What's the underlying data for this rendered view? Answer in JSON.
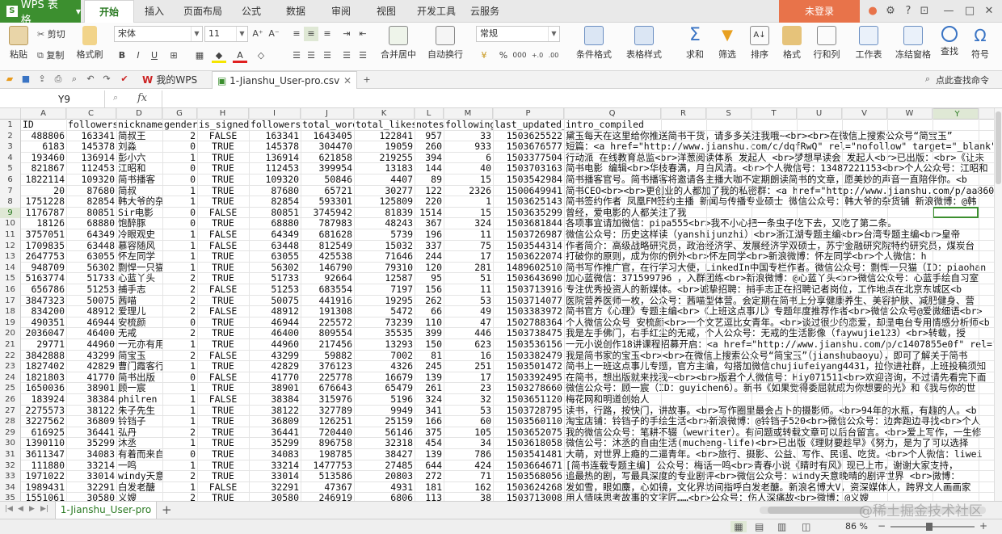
{
  "app": {
    "logo": "WPS 表格",
    "login": "未登录"
  },
  "menu_tabs": [
    "开始",
    "插入",
    "页面布局",
    "公式",
    "数据",
    "审阅",
    "视图",
    "开发工具",
    "云服务"
  ],
  "ribbon": {
    "paste": "粘贴",
    "cut": "剪切",
    "copy": "复制",
    "format_painter": "格式刷",
    "font_name": "宋体",
    "font_size": "11",
    "merge_center": "合并居中",
    "wrap": "自动换行",
    "number_format": "常规",
    "cond_format": "条件格式",
    "table_style": "表格样式",
    "sum": "求和",
    "filter": "筛选",
    "sort": "排序",
    "format": "格式",
    "row_col": "行和列",
    "worksheet": "工作表",
    "freeze": "冻结窗格",
    "find": "查找",
    "symbol": "符号"
  },
  "qa": {
    "home_tab": "我的WPS",
    "doc_tab": "1-Jianshu_User-pro.csv",
    "cmd_search": "点此查找命令"
  },
  "formula_bar": {
    "name_box": "Y9",
    "fx": "fx"
  },
  "columns": [
    "A",
    "B",
    "C",
    "D",
    "G",
    "H",
    "I",
    "J",
    "K",
    "L",
    "M",
    "P",
    "Q",
    "R",
    "S",
    "T",
    "U",
    "V",
    "W",
    "X",
    "Y"
  ],
  "rows": [
    {
      "n": "1",
      "a": "ID",
      "c": "followers",
      "d": "nickname",
      "g": "gender",
      "h": "is_signed",
      "i": "followers",
      "j": "total_word",
      "k": "total_likes",
      "l": "notes",
      "m": "following",
      "p": "last_updated_a",
      "q": "intro_compiled"
    },
    {
      "n": "2",
      "a": "488806",
      "c": "163341",
      "d": "简叔王",
      "g": "2",
      "h": "FALSE",
      "i": "163341",
      "j": "1643405",
      "k": "122841",
      "l": "957",
      "m": "33",
      "p": "1503625522",
      "q": "黛玉每天在这里给你推送简书干货，请多多关注我哦~<br><br>在微信上搜索公众号“简宝玉”"
    },
    {
      "n": "3",
      "a": "6183",
      "c": "145378",
      "d": "刘淼",
      "g": "0",
      "h": "TRUE",
      "i": "145378",
      "j": "304470",
      "k": "19059",
      "l": "260",
      "m": "933",
      "p": "1503676577",
      "q": "短篇：<a href=\"http://www.jianshu.com/c/dqfRwQ\" rel=\"nofollow\" target=\"_blank\">htt"
    },
    {
      "n": "4",
      "a": "193460",
      "c": "136914",
      "d": "彭小六",
      "g": "1",
      "h": "TRUE",
      "i": "136914",
      "j": "621858",
      "k": "219255",
      "l": "394",
      "m": "6",
      "p": "1503377504",
      "q": "行动派 在线教育总监<br>洋葱阅读体系 发起人 <br>梦想早读会 发起人<br>已出版：<br>《让未"
    },
    {
      "n": "5",
      "a": "821867",
      "c": "112453",
      "d": "江昭和",
      "g": "0",
      "h": "TRUE",
      "i": "112453",
      "j": "399954",
      "k": "13183",
      "l": "144",
      "m": "40",
      "p": "1503703163",
      "q": "简书电影 编辑<br>华枝春满，月白风清。<br>个人微信号：13487221153<br>个人公众号：江昭和"
    },
    {
      "n": "6",
      "a": "1822114",
      "c": "109320",
      "d": "简书播客",
      "g": "0",
      "h": "TRUE",
      "i": "109320",
      "j": "50846",
      "k": "4407",
      "l": "89",
      "m": "15",
      "p": "1503542984",
      "q": "简书播客官号。简书播客将邀请各主播大咖不定期朗读简书的文章，愿美妙的声音一直陪伴你。<b"
    },
    {
      "n": "7",
      "a": "20",
      "c": "87680",
      "d": "简叔",
      "g": "1",
      "h": "TRUE",
      "i": "87680",
      "j": "65721",
      "k": "30277",
      "l": "122",
      "m": "2326",
      "p": "1500649941",
      "q": "简书CEO<br><br>更创业的人都加了我的私密群：<a href=\"http://www.jianshu.com/p/aa860ce"
    },
    {
      "n": "8",
      "a": "1751228",
      "c": "82854",
      "d": "韩大爷的杂",
      "g": "1",
      "h": "TRUE",
      "i": "82854",
      "j": "593301",
      "k": "125809",
      "l": "220",
      "m": "1",
      "p": "1503625143",
      "q": "简书签约作者 凤凰FM签约主播 新闻与传播专业硕士 微信公众号：韩大爷的杂货铺  新浪微博：@韩"
    },
    {
      "n": "9",
      "a": "1176787",
      "c": "80851",
      "d": "Sir电影",
      "g": "0",
      "h": "FALSE",
      "i": "80851",
      "j": "3745942",
      "k": "81839",
      "l": "1514",
      "m": "15",
      "p": "1503635299",
      "q": "曾经，爱电影的人都关注了我"
    },
    {
      "n": "10",
      "a": "18126",
      "c": "68880",
      "d": "饱醉豚",
      "g": "0",
      "h": "TRUE",
      "i": "68880",
      "j": "787983",
      "k": "48243",
      "l": "367",
      "m": "324",
      "p": "1503681844",
      "q": "各项事宜请加微信：pipa555<br>我不小心把一条虫子吃下去，又吃了第二条。"
    },
    {
      "n": "11",
      "a": "3757051",
      "c": "64349",
      "d": "冷眼观史",
      "g": "1",
      "h": "FALSE",
      "i": "64349",
      "j": "681628",
      "k": "5739",
      "l": "196",
      "m": "11",
      "p": "1503726987",
      "q": "微信公众号：历史这样读（yanshijunzhi）<br>浙江湖专题主编<br>台湾专题主编<br>皇帝"
    },
    {
      "n": "12",
      "a": "1709835",
      "c": "63448",
      "d": "慕容随风",
      "g": "1",
      "h": "FALSE",
      "i": "63448",
      "j": "812549",
      "k": "15032",
      "l": "337",
      "m": "75",
      "p": "1503544314",
      "q": "作者简介：高级战略研究员，政治经济学、发展经济学双硕士，苏宁金融研究院特约研究员，煤炭台"
    },
    {
      "n": "13",
      "a": "2647753",
      "c": "63055",
      "d": "怀左同学",
      "g": "1",
      "h": "TRUE",
      "i": "63055",
      "j": "425538",
      "k": "71646",
      "l": "244",
      "m": "17",
      "p": "1503622074",
      "q": "打破你的原则，成为你的例外<br>怀左同学<br>新浪微博：怀左同学<br>个人微信：h"
    },
    {
      "n": "14",
      "a": "948709",
      "c": "56302",
      "d": "剽悍一只猫",
      "g": "1",
      "h": "TRUE",
      "i": "56302",
      "j": "146790",
      "k": "79310",
      "l": "120",
      "m": "281",
      "p": "1489602510",
      "q": "简书写作推广官，在行学习大使，LinkedIn中国专栏作者。微信公众号：剽悍一只猫（ID：piaohan"
    },
    {
      "n": "15",
      "a": "5163774",
      "c": "51733",
      "d": "心蓝丫头",
      "g": "2",
      "h": "TRUE",
      "i": "51733",
      "j": "92664",
      "k": "12587",
      "l": "95",
      "m": "51",
      "p": "1503643690",
      "q": "加心蓝微信：371599796  ，入群团练<br>新浪微博：@心蓝丫头<br>微信公众号：心蓝手绘自习室"
    },
    {
      "n": "16",
      "a": "656786",
      "c": "51253",
      "d": "捕手志",
      "g": "2",
      "h": "FALSE",
      "i": "51253",
      "j": "683554",
      "k": "7197",
      "l": "156",
      "m": "11",
      "p": "1503713916",
      "q": "专注优秀投资人的新媒体。<br>诚挚招聘：捕手志正在招聘记者岗位，工作地点在北京东城区<b"
    },
    {
      "n": "17",
      "a": "3847323",
      "c": "50075",
      "d": "茜喵",
      "g": "2",
      "h": "TRUE",
      "i": "50075",
      "j": "441916",
      "k": "19295",
      "l": "262",
      "m": "53",
      "p": "1503714077",
      "q": "医院营养医师一枚，公众号：茜喵型体营。会定期在简书上分享健康养生、美容护肤、减肥健身、营"
    },
    {
      "n": "18",
      "a": "834200",
      "c": "48912",
      "d": "爱理儿",
      "g": "2",
      "h": "FALSE",
      "i": "48912",
      "j": "191308",
      "k": "5472",
      "l": "66",
      "m": "49",
      "p": "1503383972",
      "q": "简书官方《心理》专题主编<br>《上班这点事儿》专题年度推荐作者<br>微信公众号@爱微细语<br>"
    },
    {
      "n": "19",
      "a": "490351",
      "c": "46944",
      "d": "安梳颜",
      "g": "0",
      "h": "TRUE",
      "i": "46944",
      "j": "225572",
      "k": "73239",
      "l": "110",
      "m": "47",
      "p": "1502788364",
      "q": "个人微信公众号 安梳颜<br>一个文艺逗比女青年。<br>谈过很少的恋爱，却是电台专用情感分析师<b"
    },
    {
      "n": "20",
      "a": "2036047",
      "c": "46400",
      "d": "无戒",
      "g": "2",
      "h": "TRUE",
      "i": "46400",
      "j": "809554",
      "k": "35535",
      "l": "399",
      "m": "446",
      "p": "1503738475",
      "q": "我是左手佛门，右手红尘的无戒，个人公众号：无戒的生活影像（faywujie123）<br>转载，授"
    },
    {
      "n": "21",
      "a": "29771",
      "c": "44960",
      "d": "一元亦有用",
      "g": "1",
      "h": "TRUE",
      "i": "44960",
      "j": "217456",
      "k": "13293",
      "l": "150",
      "m": "623",
      "p": "1503536156",
      "q": "一元小说创作18讲课程招募开启：<a href=\"http://www.jianshu.com/p/c1407855e0f\" rel=\""
    },
    {
      "n": "22",
      "a": "3842888",
      "c": "43299",
      "d": "简宝玉",
      "g": "2",
      "h": "FALSE",
      "i": "43299",
      "j": "59882",
      "k": "7002",
      "l": "81",
      "m": "16",
      "p": "1503382479",
      "q": "我是简书家的宝玉<br><br>在微信上搜索公众号“简宝玉”（jianshubaoyu），即可了解关于简书"
    },
    {
      "n": "23",
      "a": "1827402",
      "c": "42829",
      "d": "曹门霞客行",
      "g": "1",
      "h": "TRUE",
      "i": "42829",
      "j": "376123",
      "k": "4326",
      "l": "245",
      "m": "251",
      "p": "1503501472",
      "q": "简书上一班这点事儿专题，官方主编，勾搭加微信chujiufeiyang4431，拉你进社群，上班投稿须知"
    },
    {
      "n": "24",
      "a": "1821803",
      "c": "41770",
      "d": "简书出版",
      "g": "0",
      "h": "FALSE",
      "i": "41770",
      "j": "225778",
      "k": "16679",
      "l": "139",
      "m": "17",
      "p": "1503392495",
      "q": "在简书，想出版就来找我~<br><br>版君个人微信号：Hiy071511<br>欢迎咨询，不过请先看完下面"
    },
    {
      "n": "25",
      "a": "1650036",
      "c": "38901",
      "d": "顾一宸",
      "g": "1",
      "h": "TRUE",
      "i": "38901",
      "j": "676643",
      "k": "65479",
      "l": "261",
      "m": "23",
      "p": "1503278660",
      "q": "微信公众号：顾一宸（ID：guyichen6）。新书《如果觉得委屈就成为你想要的光》和《我与你的世"
    },
    {
      "n": "26",
      "a": "183924",
      "c": "38384",
      "d": "philren",
      "g": "1",
      "h": "FALSE",
      "i": "38384",
      "j": "315976",
      "k": "5196",
      "l": "324",
      "m": "32",
      "p": "1503651120",
      "q": "梅花网和明道创始人"
    },
    {
      "n": "27",
      "a": "2275573",
      "c": "38122",
      "d": "朱子先生",
      "g": "1",
      "h": "TRUE",
      "i": "38122",
      "j": "327789",
      "k": "9949",
      "l": "341",
      "m": "53",
      "p": "1503728795",
      "q": "读书，行路，按快门，讲故事。<br>写作圈里最会占卜的摄影师。<br>94年的水瓶，有趣的人。<b"
    },
    {
      "n": "28",
      "a": "3227562",
      "c": "36809",
      "d": "铃铛子",
      "g": "1",
      "h": "TRUE",
      "i": "36809",
      "j": "126251",
      "k": "25159",
      "l": "166",
      "m": "60",
      "p": "1503560110",
      "q": "淘宝店铺：铃铛子的手绘生活<br>新浪微博：@铃铛子520<br>微信公众号：边奔跑边寻找<br>个人"
    },
    {
      "n": "29",
      "a": "616925",
      "c": "36441",
      "d": "弘丹",
      "g": "2",
      "h": "TRUE",
      "i": "36441",
      "j": "720440",
      "k": "56146",
      "l": "375",
      "m": "105",
      "p": "1503652075",
      "q": "我的微信公众号：笔耕不辍（wewriter）。有问题或转载文章可以后台留言。<br>爱上写作，一生修"
    },
    {
      "n": "30",
      "a": "1390110",
      "c": "35299",
      "d": "沐丞",
      "g": "1",
      "h": "TRUE",
      "i": "35299",
      "j": "896758",
      "k": "32318",
      "l": "454",
      "m": "34",
      "p": "1503618058",
      "q": "微信公号：沐丞的自由生活(mucheng-life)<br>已出版《理财要趁早》《努力，是为了可以选择"
    },
    {
      "n": "31",
      "a": "3611347",
      "c": "34083",
      "d": "有着而来自",
      "g": "0",
      "h": "TRUE",
      "i": "34083",
      "j": "198785",
      "k": "38427",
      "l": "139",
      "m": "786",
      "p": "1503541481",
      "q": "大萌，对世界上瘾的二逼青年。<br>旅行、摄影、公益、写作、民谣、吃货。<br>个人微信：liwei"
    },
    {
      "n": "32",
      "a": "111880",
      "c": "33214",
      "d": "一鸣",
      "g": "1",
      "h": "TRUE",
      "i": "33214",
      "j": "1477753",
      "k": "27485",
      "l": "644",
      "m": "424",
      "p": "1503664671",
      "q": "[简书连载专题主编] 公众号：梅话一鸣<br>青春小说《睛时有风》现已上市，谢谢大家支持，"
    },
    {
      "n": "33",
      "a": "1971022",
      "c": "33014",
      "d": "windy天意",
      "g": "2",
      "h": "TRUE",
      "i": "33014",
      "j": "513586",
      "k": "20803",
      "l": "272",
      "m": "71",
      "p": "1503568056",
      "q": "追最热的剧，写最具深度的专业剧评<br>微信公众号：windy天意晚晴的剧评世界      <br>微博："
    },
    {
      "n": "34",
      "a": "1989431",
      "c": "32291",
      "d": "白发老醣",
      "g": "1",
      "h": "FALSE",
      "i": "32291",
      "j": "47367",
      "k": "4931",
      "l": "181",
      "m": "162",
      "p": "1503624268",
      "q": " 发如雪，眼如麋，心如镜，文化界坊间指呼白发老醣。新浪名博大V，资深媒体人，跨界文人画画家"
    },
    {
      "n": "35",
      "a": "1551061",
      "c": "30580",
      "d": "义嫂",
      "g": "2",
      "h": "TRUE",
      "i": "30580",
      "j": "246919",
      "k": "6806",
      "l": "113",
      "m": "38",
      "p": "1503713008",
      "q": "用人情味思考故事的文字匠……<br>公众号：伤人深痛故<br>微博：@义嫂"
    }
  ],
  "sheet": {
    "name": "1-Jianshu_User-pro"
  },
  "status": {
    "zoom": "86 %"
  },
  "watermark": "@稀土掘金技术社区"
}
